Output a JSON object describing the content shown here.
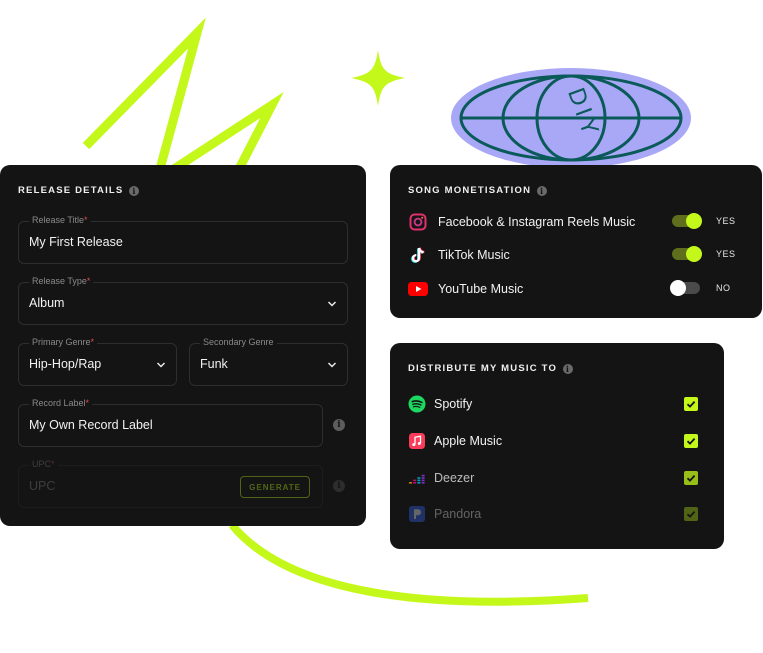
{
  "colors": {
    "accent": "#c4f81a",
    "card_bg": "#141414",
    "badge_purple": "#a9a8f6",
    "badge_teal": "#0b5a5a"
  },
  "badge": {
    "text": "DIY"
  },
  "release": {
    "title": "RELEASE DETAILS",
    "info_glyph": "i",
    "fields": {
      "release_title": {
        "label": "Release Title",
        "value": "My First Release"
      },
      "release_type": {
        "label": "Release Type",
        "value": "Album"
      },
      "primary_genre": {
        "label": "Primary Genre",
        "value": "Hip-Hop/Rap"
      },
      "secondary_genre": {
        "label": "Secondary Genre",
        "value": "Funk"
      },
      "record_label": {
        "label": "Record Label",
        "value": "My Own Record Label"
      },
      "upc": {
        "label": "UPC",
        "placeholder": "UPC",
        "button": "GENERATE"
      }
    },
    "required_mark": "*"
  },
  "monetisation": {
    "title": "SONG MONETISATION",
    "items": [
      {
        "icon": "instagram-icon",
        "label": "Facebook & Instagram Reels Music",
        "enabled": true,
        "state_label": "YES"
      },
      {
        "icon": "tiktok-icon",
        "label": "TikTok Music",
        "enabled": true,
        "state_label": "YES"
      },
      {
        "icon": "youtube-icon",
        "label": "YouTube Music",
        "enabled": false,
        "state_label": "NO"
      }
    ]
  },
  "distribute": {
    "title": "DISTRIBUTE MY MUSIC TO",
    "items": [
      {
        "icon": "spotify-icon",
        "label": "Spotify",
        "checked": true
      },
      {
        "icon": "apple-music-icon",
        "label": "Apple Music",
        "checked": true
      },
      {
        "icon": "deezer-icon",
        "label": "Deezer",
        "checked": true
      },
      {
        "icon": "pandora-icon",
        "label": "Pandora",
        "checked": true
      }
    ]
  }
}
